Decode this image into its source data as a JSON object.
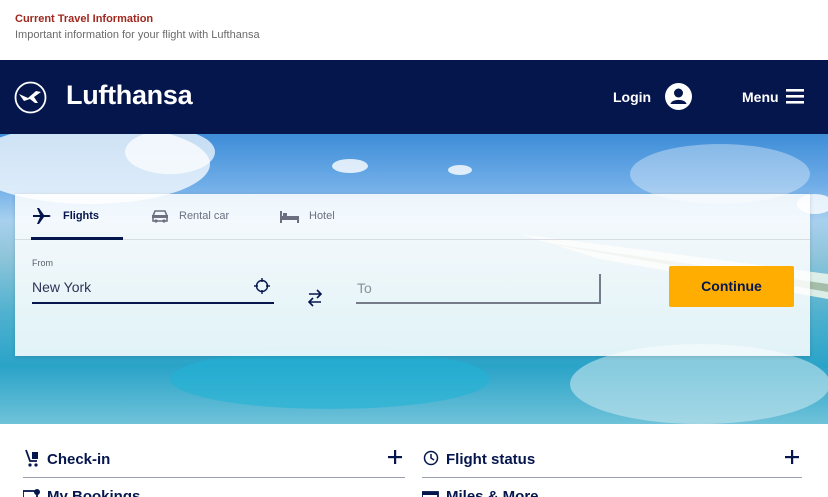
{
  "banner": {
    "title": "Current Travel Information",
    "subtitle": "Important information for your flight with Lufthansa"
  },
  "header": {
    "brand": "Lufthansa",
    "login_label": "Login",
    "menu_label": "Menu",
    "background_color": "#05164d"
  },
  "booking": {
    "tabs": [
      {
        "label": "Flights",
        "icon": "airplane-icon",
        "active": true
      },
      {
        "label": "Rental car",
        "icon": "car-icon",
        "active": false
      },
      {
        "label": "Hotel",
        "icon": "bed-icon",
        "active": false
      }
    ],
    "from_label": "From",
    "from_value": "New York",
    "to_placeholder": "To",
    "continue_label": "Continue",
    "accent_color": "#ffad00"
  },
  "quick_links": [
    {
      "label": "Check-in",
      "icon": "check-in-icon"
    },
    {
      "label": "Flight status",
      "icon": "clock-icon"
    },
    {
      "label": "My Bookings",
      "icon": "ticket-icon"
    },
    {
      "label": "Miles & More",
      "icon": "card-icon"
    }
  ]
}
